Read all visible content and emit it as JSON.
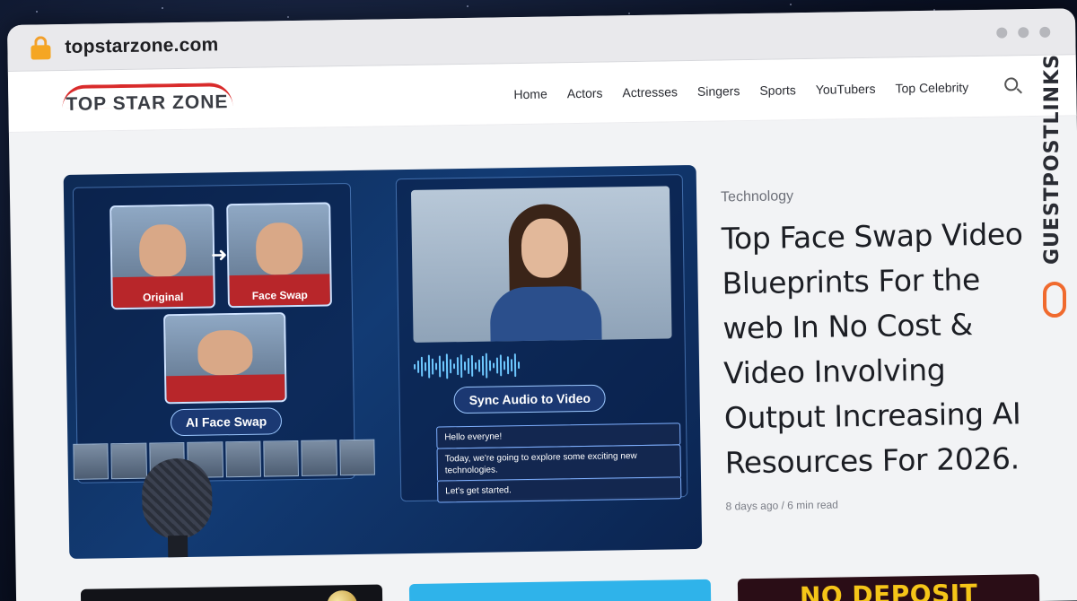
{
  "browser": {
    "url": "topstarzone.com"
  },
  "site": {
    "logo_text": "TOP STAR ZONE",
    "nav": [
      "Home",
      "Actors",
      "Actresses",
      "Singers",
      "Sports",
      "YouTubers",
      "Top Celebrity"
    ]
  },
  "featured": {
    "category": "Technology",
    "title": "Top Face Swap Video Blueprints For the web In No Cost & Video Involving Output Increasing AI Resources For 2026.",
    "meta": "8 days ago / 6 min read",
    "image": {
      "original_label": "Original",
      "faceswap_label": "Face Swap",
      "ai_face_swap_label": "AI Face Swap",
      "sync_label": "Sync Audio to Video",
      "chat_lines": [
        "Hello everyne!",
        "Today, we're going to explore some exciting new technologies.",
        "Let's get started."
      ]
    }
  },
  "cards": {
    "promo_text": "NO DEPOSIT"
  },
  "watermark": {
    "text": "GUESTPOSTLINKS"
  },
  "colors": {
    "accent_red": "#d92b2b",
    "lock": "#f5a623",
    "watermark_orange": "#f06a2e"
  }
}
